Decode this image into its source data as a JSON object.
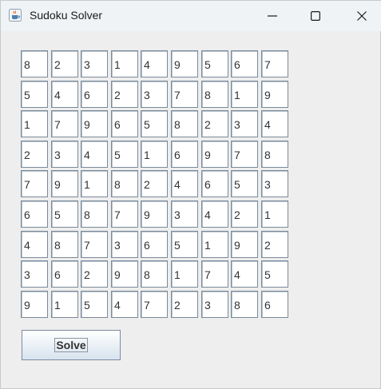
{
  "window": {
    "title": "Sudoku Solver"
  },
  "board": [
    [
      "8",
      "2",
      "3",
      "1",
      "4",
      "9",
      "5",
      "6",
      "7"
    ],
    [
      "5",
      "4",
      "6",
      "2",
      "3",
      "7",
      "8",
      "1",
      "9"
    ],
    [
      "1",
      "7",
      "9",
      "6",
      "5",
      "8",
      "2",
      "3",
      "4"
    ],
    [
      "2",
      "3",
      "4",
      "5",
      "1",
      "6",
      "9",
      "7",
      "8"
    ],
    [
      "7",
      "9",
      "1",
      "8",
      "2",
      "4",
      "6",
      "5",
      "3"
    ],
    [
      "6",
      "5",
      "8",
      "7",
      "9",
      "3",
      "4",
      "2",
      "1"
    ],
    [
      "4",
      "8",
      "7",
      "3",
      "6",
      "5",
      "1",
      "9",
      "2"
    ],
    [
      "3",
      "6",
      "2",
      "9",
      "8",
      "1",
      "7",
      "4",
      "5"
    ],
    [
      "9",
      "1",
      "5",
      "4",
      "7",
      "2",
      "3",
      "8",
      "6"
    ]
  ],
  "actions": {
    "solve_label": "Solve"
  },
  "icons": {
    "app": "java-coffee-cup-icon",
    "minimize": "minimize-icon",
    "maximize": "maximize-icon",
    "close": "close-icon"
  }
}
